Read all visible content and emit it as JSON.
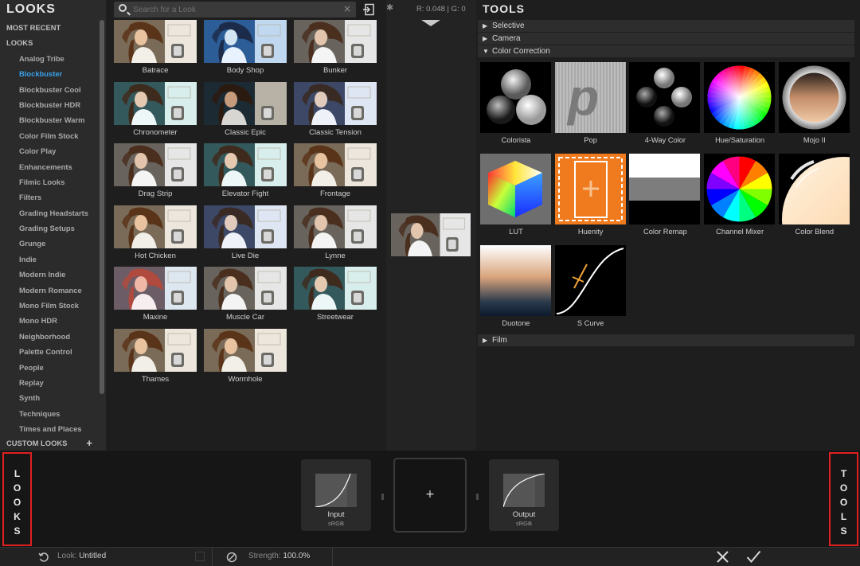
{
  "sidebar": {
    "title": "LOOKS",
    "categories": [
      {
        "label": "MOST RECENT",
        "kind": "head"
      },
      {
        "label": "LOOKS",
        "kind": "head"
      },
      {
        "label": "Analog Tribe",
        "kind": "sub"
      },
      {
        "label": "Blockbuster",
        "kind": "sub",
        "active": true
      },
      {
        "label": "Blockbuster Cool",
        "kind": "sub"
      },
      {
        "label": "Blockbuster HDR",
        "kind": "sub"
      },
      {
        "label": "Blockbuster Warm",
        "kind": "sub"
      },
      {
        "label": "Color Film Stock",
        "kind": "sub"
      },
      {
        "label": "Color Play",
        "kind": "sub"
      },
      {
        "label": "Enhancements",
        "kind": "sub"
      },
      {
        "label": "Filmic Looks",
        "kind": "sub"
      },
      {
        "label": "Filters",
        "kind": "sub"
      },
      {
        "label": "Grading Headstarts",
        "kind": "sub"
      },
      {
        "label": "Grading Setups",
        "kind": "sub"
      },
      {
        "label": "Grunge",
        "kind": "sub"
      },
      {
        "label": "Indie",
        "kind": "sub"
      },
      {
        "label": "Modern Indie",
        "kind": "sub"
      },
      {
        "label": "Modern Romance",
        "kind": "sub"
      },
      {
        "label": "Mono Film Stock",
        "kind": "sub"
      },
      {
        "label": "Mono HDR",
        "kind": "sub"
      },
      {
        "label": "Neighborhood",
        "kind": "sub"
      },
      {
        "label": "Palette Control",
        "kind": "sub"
      },
      {
        "label": "People",
        "kind": "sub"
      },
      {
        "label": "Replay",
        "kind": "sub"
      },
      {
        "label": "Synth",
        "kind": "sub"
      },
      {
        "label": "Techniques",
        "kind": "sub"
      },
      {
        "label": "Times and Places",
        "kind": "sub"
      }
    ],
    "custom_looks": "CUSTOM LOOKS",
    "custom_add": "+"
  },
  "search": {
    "placeholder": "Search for a Look",
    "clear": "×"
  },
  "looks": [
    {
      "name": "Batrace",
      "tone": "warm"
    },
    {
      "name": "Body Shop",
      "tone": "blue"
    },
    {
      "name": "Bunker",
      "tone": "neutral"
    },
    {
      "name": "Chronometer",
      "tone": "teal"
    },
    {
      "name": "Classic Epic",
      "tone": "dark"
    },
    {
      "name": "Classic Tension",
      "tone": "cool"
    },
    {
      "name": "Drag Strip",
      "tone": "neutral"
    },
    {
      "name": "Elevator Fight",
      "tone": "teal"
    },
    {
      "name": "Frontage",
      "tone": "warm"
    },
    {
      "name": "Hot Chicken",
      "tone": "warm"
    },
    {
      "name": "Live Die",
      "tone": "cool"
    },
    {
      "name": "Lynne",
      "tone": "neutral"
    },
    {
      "name": "Maxine",
      "tone": "pink"
    },
    {
      "name": "Muscle Car",
      "tone": "neutral"
    },
    {
      "name": "Streetwear",
      "tone": "teal"
    },
    {
      "name": "Thames",
      "tone": "warm"
    },
    {
      "name": "Wormhole",
      "tone": "warm"
    }
  ],
  "viewer": {
    "readout": "R: 0.048 | G: 0"
  },
  "tools": {
    "title": "TOOLS",
    "sections": {
      "selective": "Selective",
      "camera": "Camera",
      "color_correction": "Color Correction",
      "film": "Film"
    },
    "items": [
      {
        "name": "Colorista",
        "icon": "colorista-icon"
      },
      {
        "name": "Pop",
        "icon": "pop-icon"
      },
      {
        "name": "4-Way Color",
        "icon": "four-way-color-icon"
      },
      {
        "name": "Hue/Saturation",
        "icon": "hue-saturation-icon"
      },
      {
        "name": "Mojo II",
        "icon": "mojo-icon"
      },
      {
        "name": "LUT",
        "icon": "lut-cube-icon"
      },
      {
        "name": "Huenity",
        "icon": "huenity-icon"
      },
      {
        "name": "Color Remap",
        "icon": "color-remap-icon"
      },
      {
        "name": "Channel Mixer",
        "icon": "channel-mixer-icon"
      },
      {
        "name": "Color Blend",
        "icon": "color-blend-icon"
      },
      {
        "name": "Duotone",
        "icon": "duotone-icon"
      },
      {
        "name": "S Curve",
        "icon": "s-curve-icon"
      }
    ]
  },
  "pipeline": {
    "looks_tab": "LOOKS",
    "tools_tab": "TOOLS",
    "input": {
      "title": "Input",
      "sub": "sRGB"
    },
    "output": {
      "title": "Output",
      "sub": "sRGB"
    },
    "add": "+"
  },
  "status": {
    "look_label": "Look:",
    "look_value": "Untitled",
    "strength_label": "Strength:",
    "strength_value": "100.0%"
  },
  "colors": {
    "accent": "#3aa0e8",
    "highlight_border": "#e02020",
    "huenity_orange": "#f07a1e"
  }
}
